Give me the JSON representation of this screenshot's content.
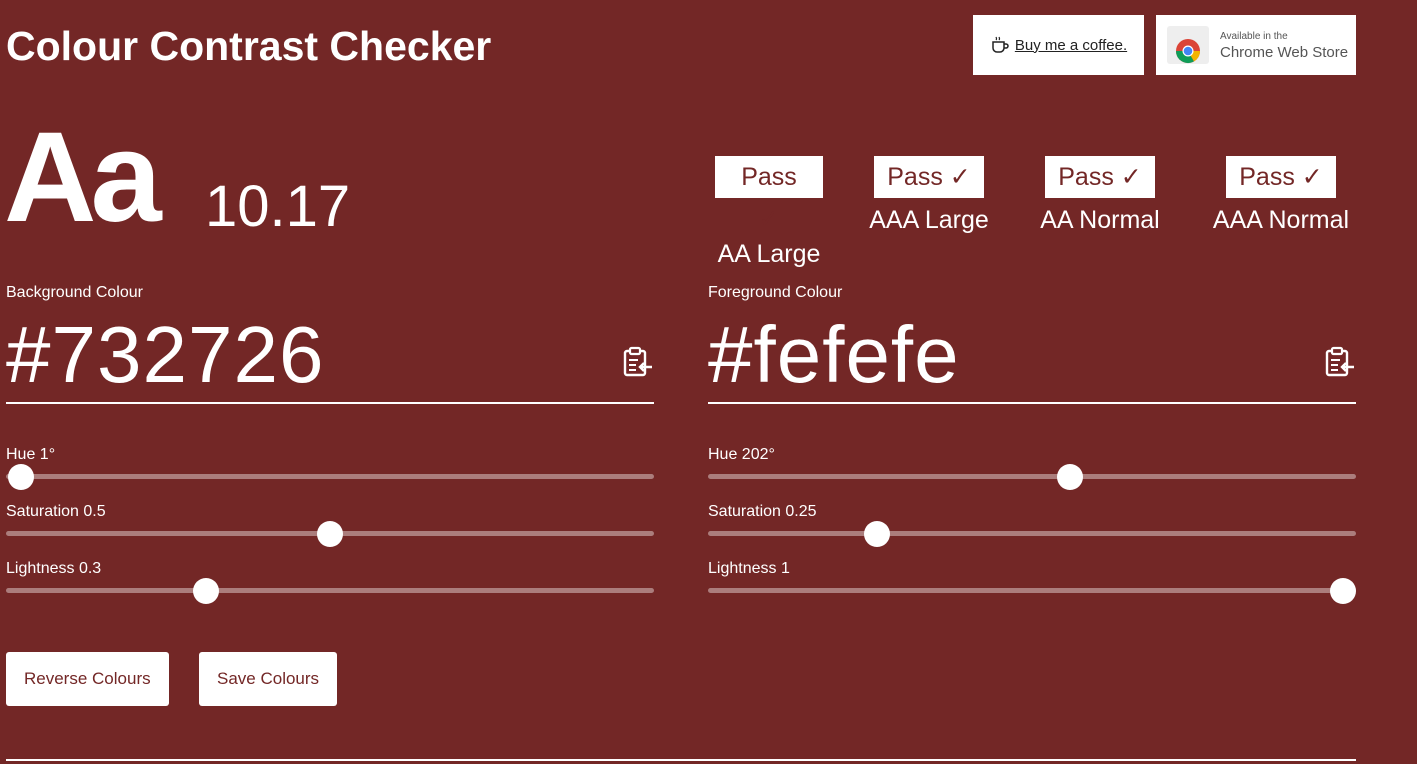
{
  "header": {
    "title": "Colour Contrast Checker",
    "coffee_label": "Buy me a coffee.",
    "coffee_icon": "coffee-cup-icon",
    "chrome_small": "Available in the",
    "chrome_big": "Chrome Web Store",
    "chrome_icon": "chrome-logo-icon"
  },
  "sample": {
    "text": "Aa",
    "ratio": "10.17"
  },
  "results": [
    {
      "badge": "Pass ✓",
      "label": "AA Large"
    },
    {
      "badge": "Pass ✓",
      "label": "AAA Large"
    },
    {
      "badge": "Pass ✓",
      "label": "AA Normal"
    },
    {
      "badge": "Pass ✓",
      "label": "AAA Normal"
    }
  ],
  "background": {
    "label": "Background Colour",
    "hex": "#732726",
    "paste_icon": "clipboard-paste-icon",
    "hue_label": "Hue 1°",
    "hue": 1,
    "saturation_label": "Saturation 0.5",
    "saturation": 0.5,
    "lightness_label": "Lightness 0.3",
    "lightness": 0.3
  },
  "foreground": {
    "label": "Foreground Colour",
    "hex": "#fefefe",
    "paste_icon": "clipboard-paste-icon",
    "hue_label": "Hue 202°",
    "hue": 202,
    "saturation_label": "Saturation 0.25",
    "saturation": 0.25,
    "lightness_label": "Lightness 1",
    "lightness": 1
  },
  "actions": {
    "reverse_label": "Reverse Colours",
    "save_label": "Save Colours"
  },
  "colors": {
    "background": "#732726",
    "foreground": "#fefefe"
  }
}
